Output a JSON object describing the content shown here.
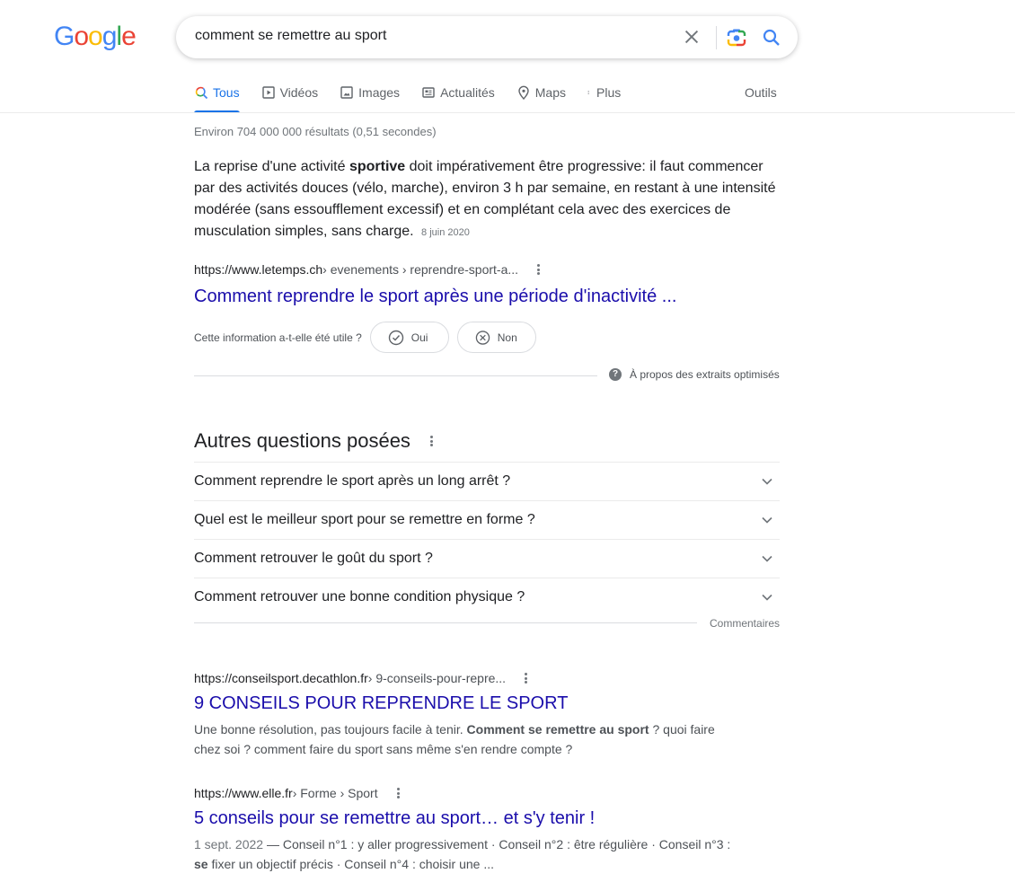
{
  "header": {
    "logo_letters": [
      {
        "char": "G",
        "color": "#4285f4"
      },
      {
        "char": "o",
        "color": "#ea4335"
      },
      {
        "char": "o",
        "color": "#fbbc05"
      },
      {
        "char": "g",
        "color": "#4285f4"
      },
      {
        "char": "l",
        "color": "#34a853"
      },
      {
        "char": "e",
        "color": "#ea4335"
      }
    ],
    "search_query": "comment se remettre au sport"
  },
  "tabs": [
    {
      "label": "Tous",
      "icon": "search-icon",
      "active": true
    },
    {
      "label": "Vidéos",
      "icon": "video-icon"
    },
    {
      "label": "Images",
      "icon": "image-icon"
    },
    {
      "label": "Actualités",
      "icon": "news-icon"
    },
    {
      "label": "Maps",
      "icon": "map-pin-icon"
    },
    {
      "label": "Plus",
      "icon": "more-vert-icon"
    }
  ],
  "tools_label": "Outils",
  "stats": "Environ 704 000 000 résultats (0,51 secondes)",
  "featured_snippet": {
    "text_before": "La reprise d'une activité ",
    "text_bold": "sportive",
    "text_after": " doit impérativement être progressive: il faut commencer par des activités douces (vélo, marche), environ 3 h par semaine, en restant à une intensité modérée (sans essoufflement excessif) et en complétant cela avec des exercices de musculation simples, sans charge.",
    "date": "8 juin 2020",
    "url_domain": "https://www.letemps.ch",
    "url_crumbs": " › evenements › reprendre-sport-a...",
    "title": "Comment reprendre le sport après une période d'inactivité ...",
    "feedback_question": "Cette information a-t-elle été utile ?",
    "yes_label": "Oui",
    "no_label": "Non",
    "about_label": "À propos des extraits optimisés"
  },
  "paa": {
    "title": "Autres questions posées",
    "questions": [
      "Comment reprendre le sport après un long arrêt ?",
      "Quel est le meilleur sport pour se remettre en forme ?",
      "Comment retrouver le goût du sport ?",
      "Comment retrouver une bonne condition physique ?"
    ],
    "feedback_label": "Commentaires"
  },
  "results": [
    {
      "url_domain": "https://conseilsport.decathlon.fr",
      "url_crumbs": " › 9-conseils-pour-repre...",
      "title": "9 CONSEILS POUR REPRENDRE LE SPORT",
      "desc_before": "Une bonne résolution, pas toujours facile à tenir. ",
      "desc_bold": "Comment se remettre au sport",
      "desc_after": " ? quoi faire chez soi ? comment faire du sport sans même s'en rendre compte ?"
    },
    {
      "url_domain": "https://www.elle.fr",
      "url_crumbs": " › Forme › Sport",
      "title": "5 conseils pour se remettre au sport… et s'y tenir !",
      "date": "1 sept. 2022",
      "desc_before": " — Conseil n°1 : y aller progressivement · Conseil n°2 : être régulière · Conseil n°3 : ",
      "desc_bold": "se",
      "desc_after": " fixer un objectif précis · Conseil n°4 : choisir une ..."
    }
  ]
}
